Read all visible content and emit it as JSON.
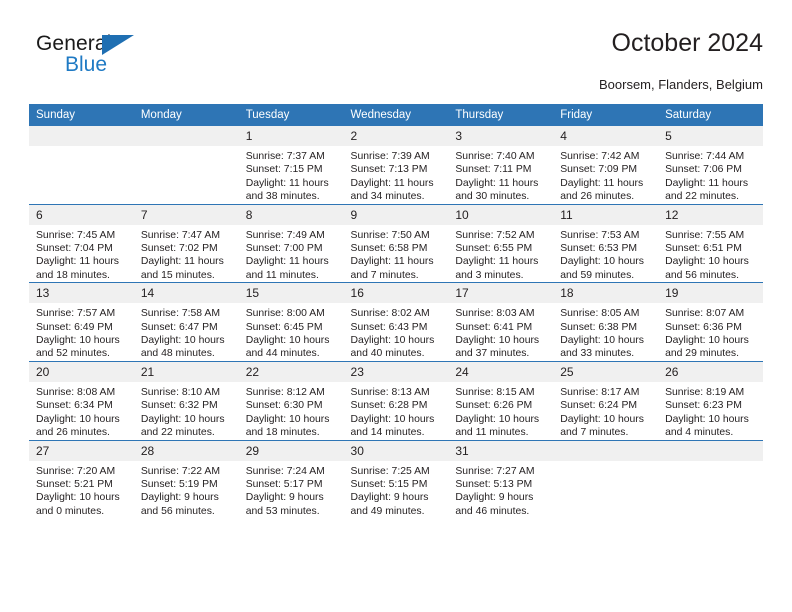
{
  "brand": {
    "name_top": "General",
    "name_bottom": "Blue",
    "triangle_color": "#1f6fb2",
    "blue_color": "#1f7ac4"
  },
  "header": {
    "title": "October 2024",
    "location": "Boorsem, Flanders, Belgium",
    "accent_color": "#2e75b5",
    "daynum_band_color": "#f0f0f0"
  },
  "calendar": {
    "weekday_headers": [
      "Sunday",
      "Monday",
      "Tuesday",
      "Wednesday",
      "Thursday",
      "Friday",
      "Saturday"
    ],
    "labels": {
      "sunrise": "Sunrise:",
      "sunset": "Sunset:",
      "daylight": "Daylight:"
    },
    "weeks": [
      [
        {
          "day": "",
          "empty": true
        },
        {
          "day": "",
          "empty": true
        },
        {
          "day": "1",
          "sunrise": "Sunrise: 7:37 AM",
          "sunset": "Sunset: 7:15 PM",
          "daylight": "Daylight: 11 hours and 38 minutes."
        },
        {
          "day": "2",
          "sunrise": "Sunrise: 7:39 AM",
          "sunset": "Sunset: 7:13 PM",
          "daylight": "Daylight: 11 hours and 34 minutes."
        },
        {
          "day": "3",
          "sunrise": "Sunrise: 7:40 AM",
          "sunset": "Sunset: 7:11 PM",
          "daylight": "Daylight: 11 hours and 30 minutes."
        },
        {
          "day": "4",
          "sunrise": "Sunrise: 7:42 AM",
          "sunset": "Sunset: 7:09 PM",
          "daylight": "Daylight: 11 hours and 26 minutes."
        },
        {
          "day": "5",
          "sunrise": "Sunrise: 7:44 AM",
          "sunset": "Sunset: 7:06 PM",
          "daylight": "Daylight: 11 hours and 22 minutes."
        }
      ],
      [
        {
          "day": "6",
          "sunrise": "Sunrise: 7:45 AM",
          "sunset": "Sunset: 7:04 PM",
          "daylight": "Daylight: 11 hours and 18 minutes."
        },
        {
          "day": "7",
          "sunrise": "Sunrise: 7:47 AM",
          "sunset": "Sunset: 7:02 PM",
          "daylight": "Daylight: 11 hours and 15 minutes."
        },
        {
          "day": "8",
          "sunrise": "Sunrise: 7:49 AM",
          "sunset": "Sunset: 7:00 PM",
          "daylight": "Daylight: 11 hours and 11 minutes."
        },
        {
          "day": "9",
          "sunrise": "Sunrise: 7:50 AM",
          "sunset": "Sunset: 6:58 PM",
          "daylight": "Daylight: 11 hours and 7 minutes."
        },
        {
          "day": "10",
          "sunrise": "Sunrise: 7:52 AM",
          "sunset": "Sunset: 6:55 PM",
          "daylight": "Daylight: 11 hours and 3 minutes."
        },
        {
          "day": "11",
          "sunrise": "Sunrise: 7:53 AM",
          "sunset": "Sunset: 6:53 PM",
          "daylight": "Daylight: 10 hours and 59 minutes."
        },
        {
          "day": "12",
          "sunrise": "Sunrise: 7:55 AM",
          "sunset": "Sunset: 6:51 PM",
          "daylight": "Daylight: 10 hours and 56 minutes."
        }
      ],
      [
        {
          "day": "13",
          "sunrise": "Sunrise: 7:57 AM",
          "sunset": "Sunset: 6:49 PM",
          "daylight": "Daylight: 10 hours and 52 minutes."
        },
        {
          "day": "14",
          "sunrise": "Sunrise: 7:58 AM",
          "sunset": "Sunset: 6:47 PM",
          "daylight": "Daylight: 10 hours and 48 minutes."
        },
        {
          "day": "15",
          "sunrise": "Sunrise: 8:00 AM",
          "sunset": "Sunset: 6:45 PM",
          "daylight": "Daylight: 10 hours and 44 minutes."
        },
        {
          "day": "16",
          "sunrise": "Sunrise: 8:02 AM",
          "sunset": "Sunset: 6:43 PM",
          "daylight": "Daylight: 10 hours and 40 minutes."
        },
        {
          "day": "17",
          "sunrise": "Sunrise: 8:03 AM",
          "sunset": "Sunset: 6:41 PM",
          "daylight": "Daylight: 10 hours and 37 minutes."
        },
        {
          "day": "18",
          "sunrise": "Sunrise: 8:05 AM",
          "sunset": "Sunset: 6:38 PM",
          "daylight": "Daylight: 10 hours and 33 minutes."
        },
        {
          "day": "19",
          "sunrise": "Sunrise: 8:07 AM",
          "sunset": "Sunset: 6:36 PM",
          "daylight": "Daylight: 10 hours and 29 minutes."
        }
      ],
      [
        {
          "day": "20",
          "sunrise": "Sunrise: 8:08 AM",
          "sunset": "Sunset: 6:34 PM",
          "daylight": "Daylight: 10 hours and 26 minutes."
        },
        {
          "day": "21",
          "sunrise": "Sunrise: 8:10 AM",
          "sunset": "Sunset: 6:32 PM",
          "daylight": "Daylight: 10 hours and 22 minutes."
        },
        {
          "day": "22",
          "sunrise": "Sunrise: 8:12 AM",
          "sunset": "Sunset: 6:30 PM",
          "daylight": "Daylight: 10 hours and 18 minutes."
        },
        {
          "day": "23",
          "sunrise": "Sunrise: 8:13 AM",
          "sunset": "Sunset: 6:28 PM",
          "daylight": "Daylight: 10 hours and 14 minutes."
        },
        {
          "day": "24",
          "sunrise": "Sunrise: 8:15 AM",
          "sunset": "Sunset: 6:26 PM",
          "daylight": "Daylight: 10 hours and 11 minutes."
        },
        {
          "day": "25",
          "sunrise": "Sunrise: 8:17 AM",
          "sunset": "Sunset: 6:24 PM",
          "daylight": "Daylight: 10 hours and 7 minutes."
        },
        {
          "day": "26",
          "sunrise": "Sunrise: 8:19 AM",
          "sunset": "Sunset: 6:23 PM",
          "daylight": "Daylight: 10 hours and 4 minutes."
        }
      ],
      [
        {
          "day": "27",
          "sunrise": "Sunrise: 7:20 AM",
          "sunset": "Sunset: 5:21 PM",
          "daylight": "Daylight: 10 hours and 0 minutes."
        },
        {
          "day": "28",
          "sunrise": "Sunrise: 7:22 AM",
          "sunset": "Sunset: 5:19 PM",
          "daylight": "Daylight: 9 hours and 56 minutes."
        },
        {
          "day": "29",
          "sunrise": "Sunrise: 7:24 AM",
          "sunset": "Sunset: 5:17 PM",
          "daylight": "Daylight: 9 hours and 53 minutes."
        },
        {
          "day": "30",
          "sunrise": "Sunrise: 7:25 AM",
          "sunset": "Sunset: 5:15 PM",
          "daylight": "Daylight: 9 hours and 49 minutes."
        },
        {
          "day": "31",
          "sunrise": "Sunrise: 7:27 AM",
          "sunset": "Sunset: 5:13 PM",
          "daylight": "Daylight: 9 hours and 46 minutes."
        },
        {
          "day": "",
          "empty": true
        },
        {
          "day": "",
          "empty": true
        }
      ]
    ]
  }
}
